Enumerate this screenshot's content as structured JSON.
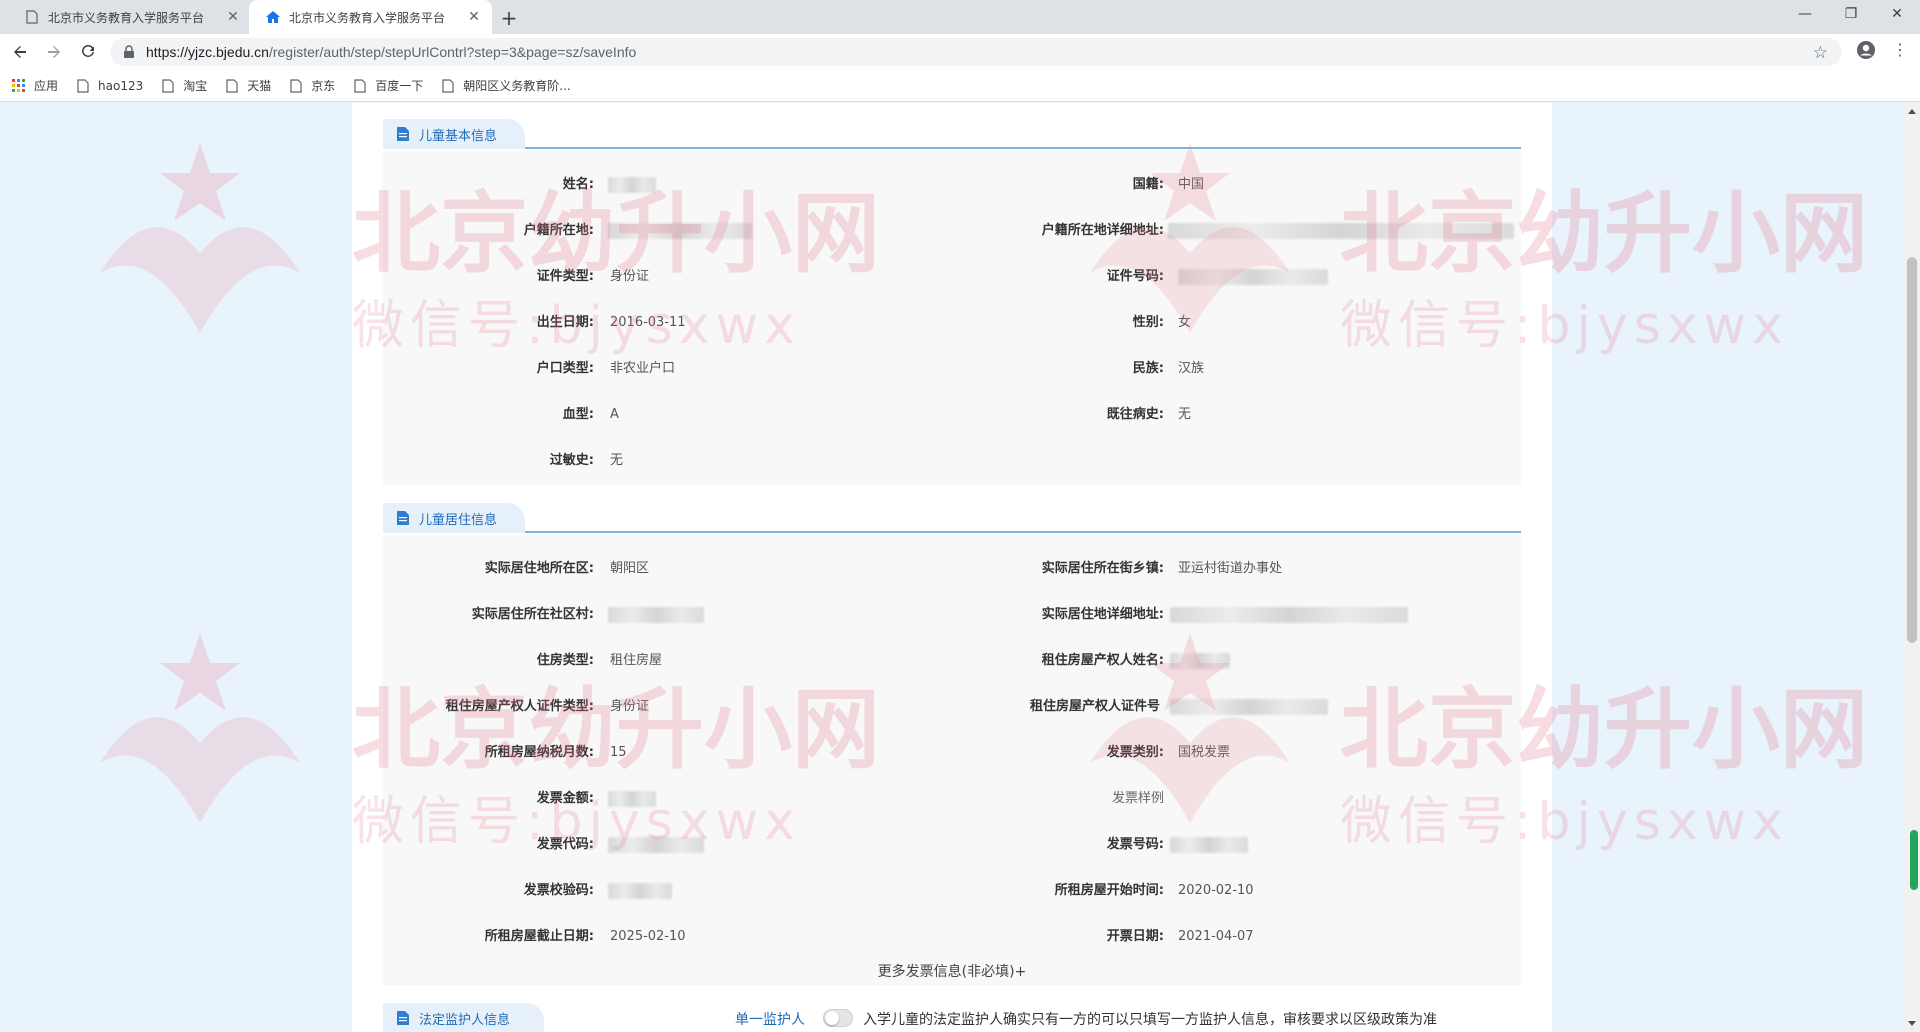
{
  "browser": {
    "tabs": [
      {
        "title": "北京市义务教育入学服务平台",
        "active": false
      },
      {
        "title": "北京市义务教育入学服务平台",
        "active": true
      }
    ],
    "url_host": "https://yjzc.bjedu.cn",
    "url_path": "/register/auth/step/stepUrlContrl?step=3&page=sz/saveInfo",
    "bookmarks": [
      "应用",
      "hao123",
      "淘宝",
      "天猫",
      "京东",
      "百度一下",
      "朝阳区义务教育阶..."
    ]
  },
  "watermark": {
    "title": "北京幼升小网",
    "subtitle": "微信号:bjysxwx"
  },
  "child_basic": {
    "heading": "儿童基本信息",
    "fields": {
      "name_label": "姓名:",
      "nationality_label": "国籍:",
      "nationality": "中国",
      "hukou_loc_label": "户籍所在地:",
      "hukou_addr_label": "户籍所在地详细地址:",
      "id_type_label": "证件类型:",
      "id_type": "身份证",
      "id_no_label": "证件号码:",
      "birth_label": "出生日期:",
      "birth": "2016-03-11",
      "gender_label": "性别:",
      "gender": "女",
      "hukou_type_label": "户口类型:",
      "hukou_type": "非农业户口",
      "ethnic_label": "民族:",
      "ethnic": "汉族",
      "blood_label": "血型:",
      "blood": "A",
      "history_label": "既往病史:",
      "history": "无",
      "allergy_label": "过敏史:",
      "allergy": "无"
    }
  },
  "child_residence": {
    "heading": "儿童居住信息",
    "fields": {
      "district_label": "实际居住地所在区:",
      "district": "朝阳区",
      "street_label": "实际居住所在街乡镇:",
      "street": "亚运村街道办事处",
      "community_label": "实际居住所在社区村:",
      "addr_label": "实际居住地详细地址:",
      "house_type_label": "住房类型:",
      "house_type": "租住房屋",
      "owner_name_label": "租住房屋产权人姓名:",
      "owner_id_type_label": "租住房屋产权人证件类型:",
      "owner_id_type": "身份证",
      "owner_id_no_label": "租住房屋产权人证件号",
      "tax_months_label": "所租房屋纳税月数:",
      "tax_months": "15",
      "invoice_type_label": "发票类别:",
      "invoice_type": "国税发票",
      "invoice_amount_label": "发票金额:",
      "invoice_sample": "发票样例",
      "invoice_code_label": "发票代码:",
      "invoice_no_label": "发票号码:",
      "invoice_check_label": "发票校验码:",
      "rent_start_label": "所租房屋开始时间:",
      "rent_start": "2020-02-10",
      "rent_end_label": "所租房屋截止日期:",
      "rent_end": "2025-02-10",
      "issue_date_label": "开票日期:",
      "issue_date": "2021-04-07"
    },
    "more": "更多发票信息(非必填)+"
  },
  "guardian": {
    "heading": "法定监护人信息",
    "single_label": "单一监护人",
    "note": "入学儿童的法定监护人确实只有一方的可以只填写一方监护人信息，审核要求以区级政策为准"
  }
}
